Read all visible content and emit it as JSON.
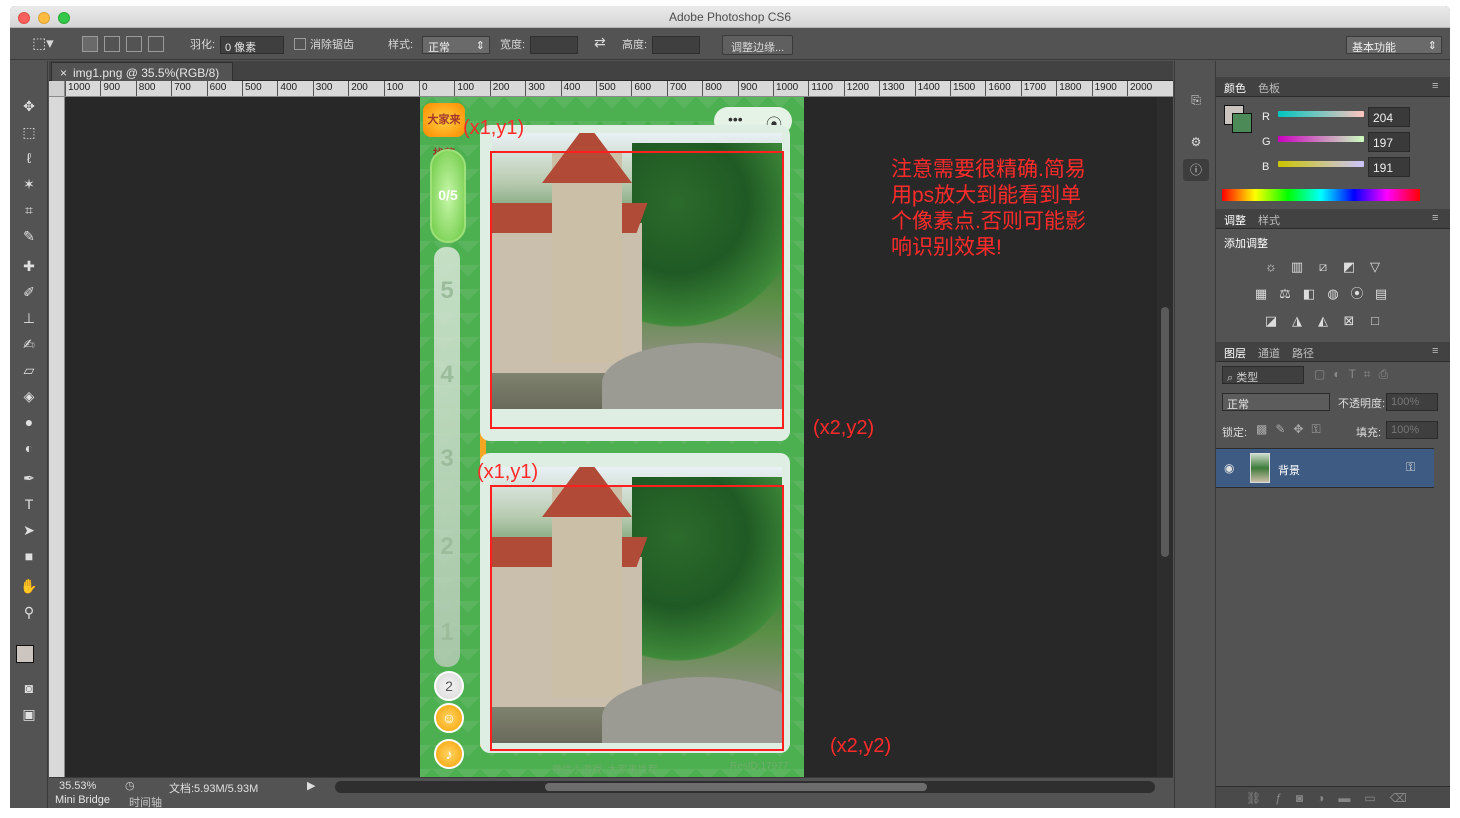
{
  "window": {
    "title": "Adobe Photoshop CS6"
  },
  "options_bar": {
    "feather_label": "羽化:",
    "feather_value": "0 像素",
    "antialias_label": "消除锯齿",
    "style_label": "样式:",
    "style_value": "正常",
    "width_label": "宽度:",
    "height_label": "高度:",
    "refine_edge_button": "调整边缘...",
    "workspace_value": "基本功能"
  },
  "document": {
    "tab_title": "img1.png @ 35.5%(RGB/8)",
    "zoom": "35.53%",
    "doc_size": "文档:5.93M/5.93M",
    "ruler_top_ticks": [
      "1000",
      "900",
      "800",
      "700",
      "600",
      "500",
      "400",
      "300",
      "200",
      "100",
      "0",
      "100",
      "200",
      "300",
      "400",
      "500",
      "600",
      "700",
      "800",
      "900",
      "1000",
      "1100",
      "1200",
      "1300",
      "1400",
      "1500",
      "1600",
      "1700",
      "1800",
      "1900",
      "2000"
    ]
  },
  "image_content": {
    "progress": "0/5",
    "levels": [
      "5",
      "4",
      "3",
      "2",
      "1"
    ],
    "logo_text": "大家来找茬",
    "capsule_dots": "•••",
    "capsule_record": "⦿",
    "badge_count": "2",
    "footer_left": "微信小游戏: 大家来找茬",
    "footer_right": "ResID:17977"
  },
  "annotations": {
    "top_left_1": "(x1,y1)",
    "bottom_right_1": "(x2,y2)",
    "top_left_2": "(x1,y1)",
    "bottom_right_2": "(x2,y2)",
    "note": "注意需要很精确.简易用ps放大到能看到单个像素点.否则可能影响识别效果!"
  },
  "color_panel": {
    "tab_color": "颜色",
    "tab_swatches": "色板",
    "r_label": "R",
    "g_label": "G",
    "b_label": "B",
    "r_value": "204",
    "g_value": "197",
    "b_value": "191",
    "foreground_hex": "#ccc5bf"
  },
  "adjust_panel": {
    "tab_adjust": "调整",
    "tab_styles": "样式",
    "add_adjustment": "添加调整"
  },
  "layers_panel": {
    "tab_layers": "图层",
    "tab_channels": "通道",
    "tab_paths": "路径",
    "filter_kind": "类型",
    "blend_mode": "正常",
    "opacity_label": "不透明度:",
    "opacity_value": "100%",
    "lock_label": "锁定:",
    "fill_label": "填充:",
    "fill_value": "100%",
    "layer_name": "背景"
  },
  "bottom_tabs": {
    "mini_bridge": "Mini Bridge",
    "timeline": "时间轴"
  }
}
